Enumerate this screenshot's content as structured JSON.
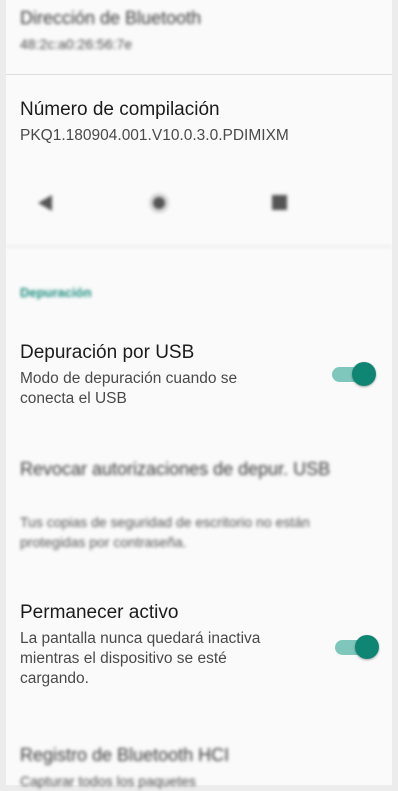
{
  "bluetooth_address": {
    "title": "Dirección de Bluetooth",
    "value": "48:2c:a0:26:56:7e"
  },
  "build_number": {
    "title": "Número de compilación",
    "value": "PKQ1.180904.001.V10.0.3.0.PDIMIXM"
  },
  "navbar": {
    "back_icon": "back-triangle-icon",
    "home_icon": "home-circle-icon",
    "recents_icon": "recents-square-icon"
  },
  "debug_section": {
    "header": "Depuración",
    "usb_debugging": {
      "title": "Depuración por USB",
      "summary": "Modo de depuración cuando se conecta el USB",
      "enabled": true
    },
    "revoke_auth": {
      "title": "Revocar autorizaciones de depur. USB"
    },
    "backup_password": {
      "summary": "Tus copias de seguridad de escritorio no están protegidas por contraseña."
    },
    "stay_awake": {
      "title": "Permanecer activo",
      "summary": "La pantalla nunca quedará inactiva mientras el dispositivo se esté cargando.",
      "enabled": true
    },
    "bt_hci_log": {
      "title": "Registro de Bluetooth HCI",
      "summary": "Capturar todos los paquetes"
    }
  },
  "colors": {
    "accent": "#0f8574",
    "accent_track": "#7fc7bd",
    "section_header": "#1a8b7e"
  }
}
